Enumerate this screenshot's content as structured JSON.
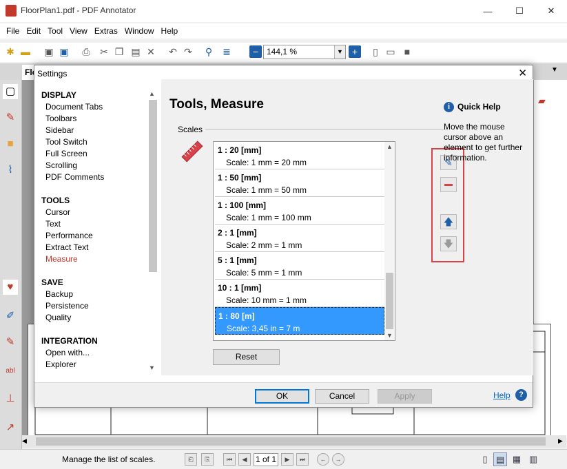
{
  "window": {
    "title": "FloorPlan1.pdf - PDF Annotator",
    "tab_label": "FloorPl",
    "menu": [
      "File",
      "Edit",
      "Tool",
      "View",
      "Extras",
      "Window",
      "Help"
    ],
    "zoom": "144,1 %"
  },
  "dialog": {
    "title": "Settings",
    "close_glyph": "✕",
    "nav": [
      {
        "header": "DISPLAY",
        "items": [
          "Document Tabs",
          "Toolbars",
          "Sidebar",
          "Tool Switch",
          "Full Screen",
          "Scrolling",
          "PDF Comments"
        ]
      },
      {
        "header": "TOOLS",
        "items": [
          "Cursor",
          "Text",
          "Performance",
          "Extract Text",
          "Measure"
        ]
      },
      {
        "header": "SAVE",
        "items": [
          "Backup",
          "Persistence",
          "Quality"
        ]
      },
      {
        "header": "INTEGRATION",
        "items": [
          "Open with...",
          "Explorer"
        ]
      }
    ],
    "active_nav": "Measure",
    "content": {
      "heading": "Tools, Measure",
      "group_label": "Scales",
      "scales": [
        {
          "name": "1 : 20 [mm]",
          "scale": "Scale: 1 mm = 20 mm"
        },
        {
          "name": "1 : 50 [mm]",
          "scale": "Scale: 1 mm = 50 mm"
        },
        {
          "name": "1 : 100 [mm]",
          "scale": "Scale: 1 mm = 100 mm"
        },
        {
          "name": "2 : 1 [mm]",
          "scale": "Scale: 2 mm = 1 mm"
        },
        {
          "name": "5 : 1 [mm]",
          "scale": "Scale: 5 mm = 1 mm"
        },
        {
          "name": "10 : 1 [mm]",
          "scale": "Scale: 10 mm = 1 mm"
        },
        {
          "name": "1 : 80 [m]",
          "scale": "Scale: 3,45 in = 7 m"
        }
      ],
      "reset_label": "Reset"
    },
    "quick_help": {
      "title": "Quick Help",
      "text": "Move the mouse cursor above an element to get further information."
    },
    "footer": {
      "ok": "OK",
      "cancel": "Cancel",
      "apply": "Apply",
      "help": "Help"
    }
  },
  "statusbar": {
    "message": "Manage the list of scales.",
    "page": "1 of 1"
  },
  "colors": {
    "accent_red": "#d9414a",
    "selection_blue": "#3399ff",
    "link_blue": "#0066cc"
  }
}
